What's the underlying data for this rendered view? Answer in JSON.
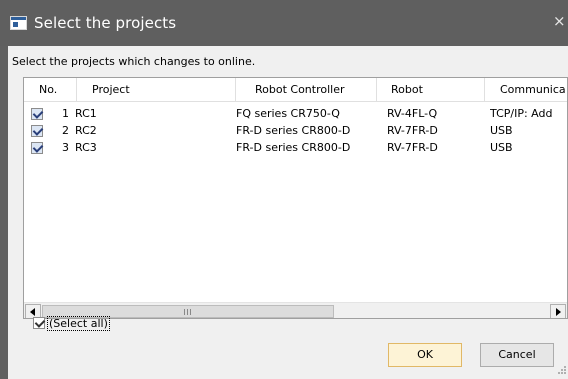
{
  "window": {
    "title": "Select the projects",
    "close_glyph": "×"
  },
  "instruction": "Select the projects which changes to online.",
  "table": {
    "columns": [
      "No.",
      "Project",
      "Robot Controller",
      "Robot",
      "Communica"
    ],
    "rows": [
      {
        "checked": true,
        "no": "1",
        "project": "RC1",
        "controller": "FQ series CR750-Q",
        "robot": "RV-4FL-Q",
        "comm": "TCP/IP: Add"
      },
      {
        "checked": true,
        "no": "2",
        "project": "RC2",
        "controller": "FR-D series CR800-D",
        "robot": "RV-7FR-D",
        "comm": "USB"
      },
      {
        "checked": true,
        "no": "3",
        "project": "RC3",
        "controller": "FR-D series CR800-D",
        "robot": "RV-7FR-D",
        "comm": "USB"
      }
    ]
  },
  "select_all": {
    "label": "(Select all)",
    "checked": true
  },
  "buttons": {
    "ok": "OK",
    "cancel": "Cancel"
  }
}
